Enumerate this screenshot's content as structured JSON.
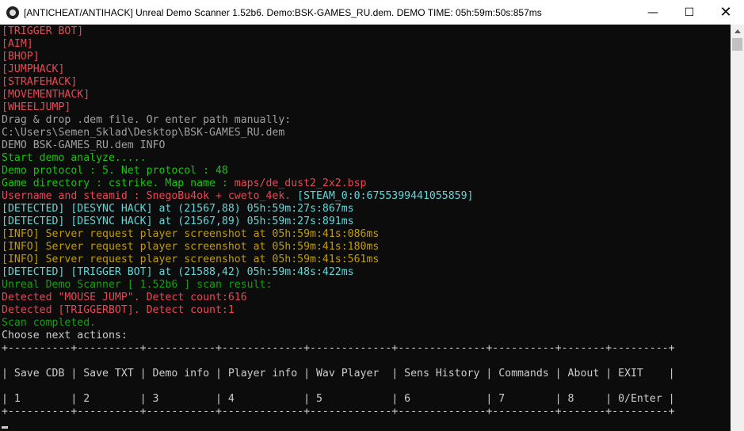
{
  "window": {
    "title": "[ANTICHEAT/ANTIHACK] Unreal Demo Scanner 1.52b6. Demo:BSK-GAMES_RU.dem. DEMO TIME: 05h:59m:50s:857ms",
    "icon": "app-icon",
    "controls": {
      "minimize": "—",
      "maximize": "☐",
      "close": "✕"
    }
  },
  "console": {
    "lines": [
      {
        "color": "red",
        "text": "[TRIGGER BOT]"
      },
      {
        "color": "red",
        "text": "[AIM]"
      },
      {
        "color": "red",
        "text": "[BHOP]"
      },
      {
        "color": "red",
        "text": "[JUMPHACK]"
      },
      {
        "color": "red",
        "text": "[STRAFEHACK]"
      },
      {
        "color": "red",
        "text": "[MOVEMENTHACK]"
      },
      {
        "color": "red",
        "text": "[WHEELJUMP]"
      },
      {
        "color": "gray",
        "text": "Drag & drop .dem file. Or enter path manually:"
      },
      {
        "color": "gray",
        "text": "C:\\Users\\Semen_Sklad\\Desktop\\BSK-GAMES_RU.dem"
      },
      {
        "color": "gray",
        "text": "DEMO BSK-GAMES_RU.dem INFO"
      },
      {
        "color": "green",
        "text": "Start demo analyze....."
      },
      {
        "color": "green",
        "text": "Demo protocol : 5. Net protocol : 48"
      },
      {
        "color": "green",
        "text": "Game directory : cstrike. Map name : ",
        "color2": "red",
        "text2": "maps/de_dust2_2x2.bsp"
      },
      {
        "color": "red",
        "text": "Username and steamid : SnegoBu4ok + cweto_4ek. ",
        "color2": "cyan",
        "text2": "[STEAM_0:0:6755399441055859]"
      },
      {
        "color": "cyan",
        "text": "[DETECTED] [DESYNC HACK] at (21567,88) 05h:59m:27s:867ms"
      },
      {
        "color": "cyan",
        "text": "[DETECTED] [DESYNC HACK] at (21567,89) 05h:59m:27s:891ms"
      },
      {
        "color": "yellow",
        "text": "[INFO] Server request player screenshot at 05h:59m:41s:086ms"
      },
      {
        "color": "yellow",
        "text": "[INFO] Server request player screenshot at 05h:59m:41s:180ms"
      },
      {
        "color": "yellow",
        "text": "[INFO] Server request player screenshot at 05h:59m:41s:561ms"
      },
      {
        "color": "cyan",
        "text": "[DETECTED] [TRIGGER BOT] at (21588,42) 05h:59m:48s:422ms"
      },
      {
        "color": "dgreen",
        "text": "Unreal Demo Scanner [ 1.52b6 ] scan result:"
      },
      {
        "color": "red",
        "text": "Detected \"MOUSE JUMP\". Detect count:616"
      },
      {
        "color": "red",
        "text": "Detected [TRIGGERBOT]. Detect count:1"
      },
      {
        "color": "dgreen",
        "text": "Scan completed."
      },
      {
        "color": "white",
        "text": "Choose next actions:"
      },
      {
        "color": "white",
        "text": "+----------+----------+-----------+-------------+-------------+--------------+----------+-------+---------+"
      },
      {
        "color": "white",
        "text": ""
      },
      {
        "color": "white",
        "text": "| Save CDB | Save TXT | Demo info | Player info | Wav Player  | Sens History | Commands | About | EXIT    |"
      },
      {
        "color": "white",
        "text": ""
      },
      {
        "color": "white",
        "text": "| 1        | 2        | 3         | 4           | 5           | 6            | 7        | 8     | 0/Enter |"
      },
      {
        "color": "white",
        "text": "+----------+----------+-----------+-------------+-------------+--------------+----------+-------+---------+"
      }
    ]
  }
}
